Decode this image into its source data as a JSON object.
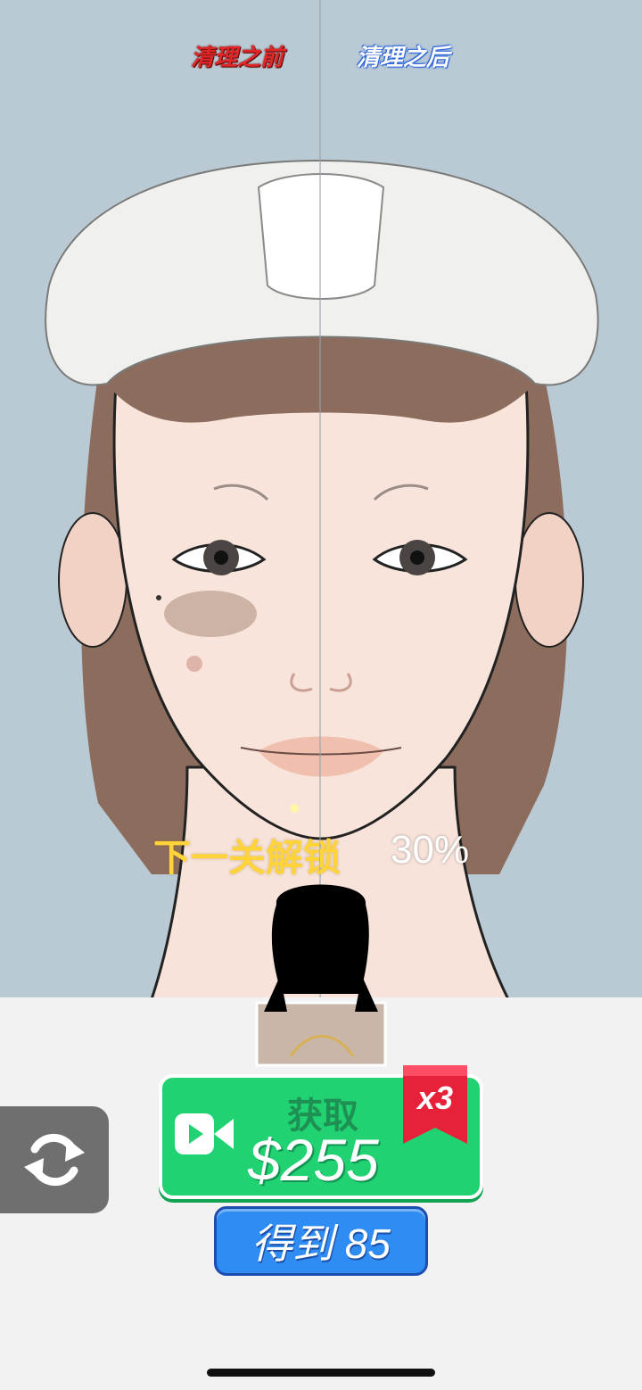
{
  "labels": {
    "before": "清理之前",
    "after": "清理之后"
  },
  "progress": {
    "unlock_text": "下一关解锁",
    "percent_text": "30%",
    "percent_value": 30
  },
  "reward_button": {
    "label": "获取",
    "amount": "$255",
    "multiplier": "x3",
    "icon": "video-camera-icon"
  },
  "get_button": {
    "label": "得到 85"
  },
  "refresh_button": {
    "icon": "refresh-icon"
  },
  "colors": {
    "green": "#20d271",
    "blue": "#2f8cf2",
    "red_ribbon": "#e8213a",
    "yellow_text": "#ffd33a"
  }
}
